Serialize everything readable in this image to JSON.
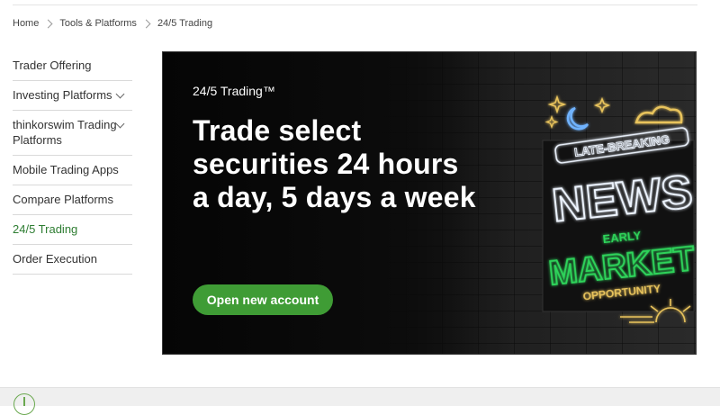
{
  "breadcrumb": [
    "Home",
    "Tools & Platforms",
    "24/5 Trading"
  ],
  "sidebar": {
    "items": [
      {
        "label": "Trader Offering",
        "chevron": false,
        "active": false
      },
      {
        "label": "Investing Platforms",
        "chevron": true,
        "active": false
      },
      {
        "label": "thinkorswim Trading Platforms",
        "chevron": true,
        "active": false
      },
      {
        "label": "Mobile Trading Apps",
        "chevron": false,
        "active": false
      },
      {
        "label": "Compare Platforms",
        "chevron": false,
        "active": false
      },
      {
        "label": "24/5 Trading",
        "chevron": false,
        "active": true
      },
      {
        "label": "Order Execution",
        "chevron": false,
        "active": false
      }
    ]
  },
  "hero": {
    "eyebrow": "24/5 Trading™",
    "headline": "Trade select securities 24 hours a day, 5 days a week",
    "cta_label": "Open new account",
    "neon_sign": {
      "line1": "LATE-BREAKING",
      "line2": "NEWS",
      "line3": "EARLY",
      "line4": "MARKET",
      "line5": "OPPORTUNITY"
    }
  },
  "colors": {
    "accent_green": "#3f9c35",
    "active_nav": "#2e7d32",
    "neon_white": "#eef5ff",
    "neon_green": "#2fd35a",
    "neon_gold": "#e8c35c"
  },
  "icons": [
    "chevron-right-icon",
    "chevron-down-icon",
    "plus-circle-icon"
  ]
}
